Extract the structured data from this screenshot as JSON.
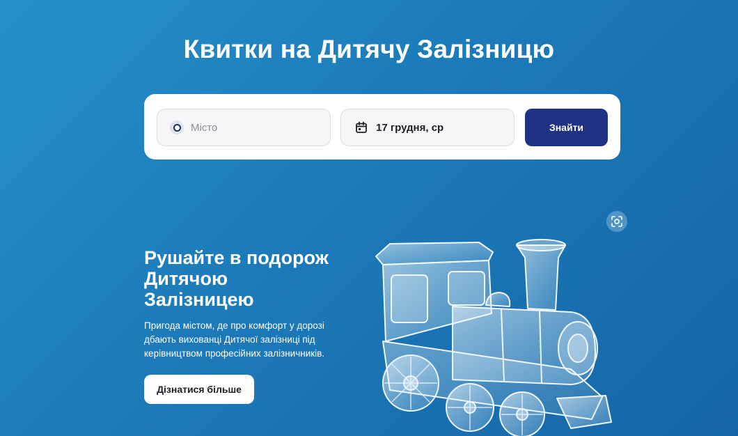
{
  "page": {
    "title": "Квитки на Дитячу Залізницю"
  },
  "search": {
    "city_placeholder": "Місто",
    "date_value": "17 грудня, ср",
    "find_label": "Знайти"
  },
  "hero": {
    "heading_line1": "Рушайте в подорож",
    "heading_line2": "Дитячою",
    "heading_line3": "Залізницею",
    "desc_line1": "Пригода містом, де про комфорт у дорозі",
    "desc_line2": "дбають вихованці Дитячої залізниці під",
    "desc_line3": "керівництвом професійних залізничників.",
    "learn_more_label": "Дізнатися більше"
  },
  "icons": {
    "city": "radio-circle-icon",
    "date": "calendar-icon",
    "scan": "scan-focus-icon",
    "illustration": "glass-train-illustration"
  },
  "colors": {
    "background_start": "#2591c8",
    "background_end": "#1565a6",
    "primary_button": "#1f3283",
    "card": "#ffffff"
  }
}
